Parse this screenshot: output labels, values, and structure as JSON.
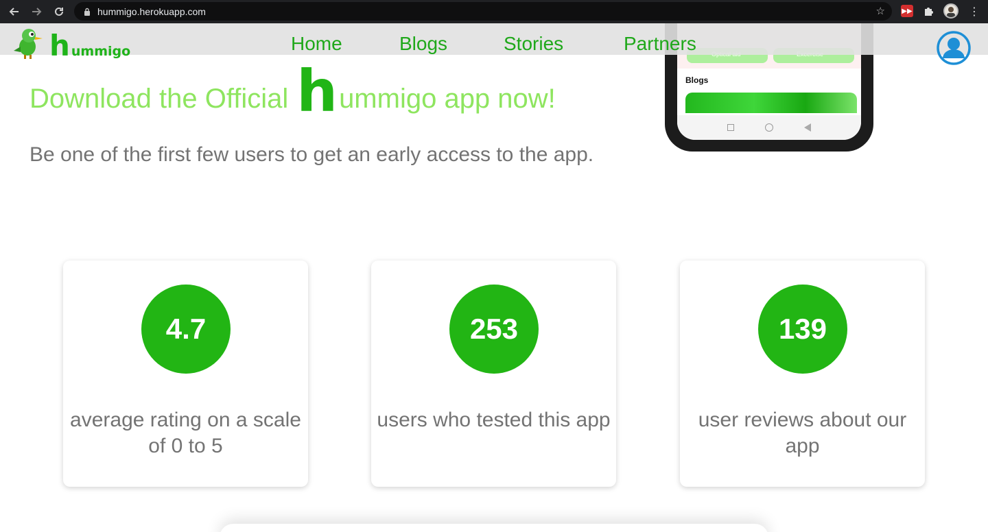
{
  "browser": {
    "url": "hummigo.herokuapp.com",
    "back_icon": "arrow-left-icon",
    "forward_icon": "arrow-right-icon",
    "reload_icon": "reload-icon",
    "extensions": [
      "red-extension-icon",
      "puzzle-icon",
      "profile-avatar",
      "kebab-menu-icon"
    ]
  },
  "navbar": {
    "logo_h": "h",
    "logo_rest": "ummigo",
    "links": [
      "Home",
      "Blogs",
      "Stories",
      "Partners"
    ]
  },
  "phone": {
    "card_left": "Optical aid",
    "card_right": "Excercise",
    "section": "Blogs"
  },
  "hero": {
    "title_pre": "Download the Official",
    "title_h": "h",
    "title_post": "ummigo app now!",
    "subtitle": "Be one of the first few users to get an early access to the app."
  },
  "stats": [
    {
      "value": "4.7",
      "label": "average rating on a scale of 0 to 5"
    },
    {
      "value": "253",
      "label": "users who tested this app"
    },
    {
      "value": "139",
      "label": "user reviews about our app"
    }
  ],
  "colors": {
    "brand_green": "#22b514",
    "hero_light_green": "#8ee55f",
    "nav_green": "#1fa81a",
    "text_gray": "#737373",
    "profile_blue": "#1e8fd6"
  }
}
